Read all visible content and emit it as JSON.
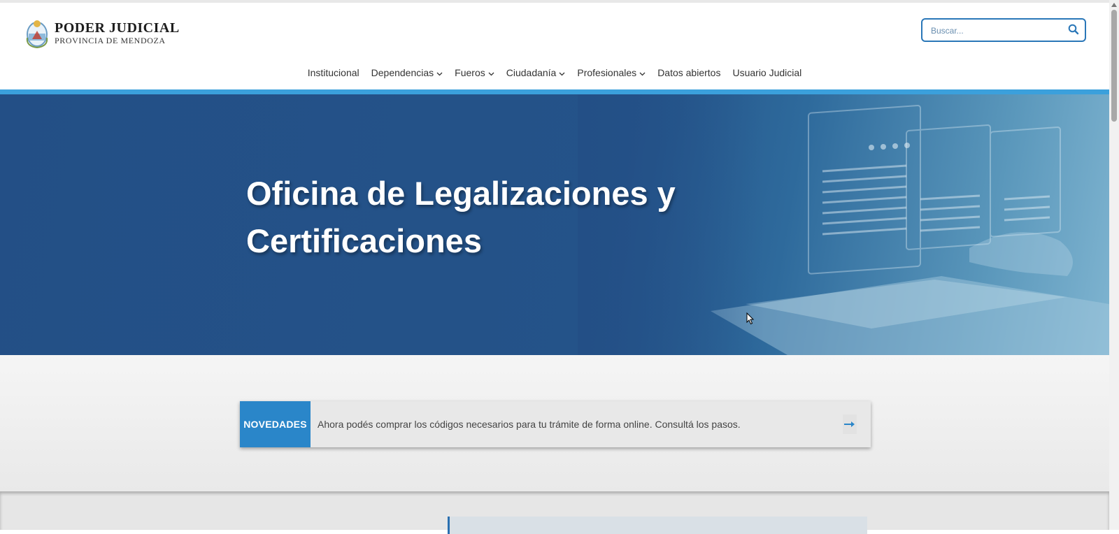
{
  "header": {
    "logo_title": "PODER JUDICIAL",
    "logo_subtitle": "PROVINCIA DE MENDOZA",
    "search_placeholder": "Buscar..."
  },
  "nav": {
    "items": [
      {
        "label": "Institucional",
        "dropdown": false
      },
      {
        "label": "Dependencias",
        "dropdown": true
      },
      {
        "label": "Fueros",
        "dropdown": true
      },
      {
        "label": "Ciudadanía",
        "dropdown": true
      },
      {
        "label": "Profesionales",
        "dropdown": true
      },
      {
        "label": "Datos abiertos",
        "dropdown": false
      },
      {
        "label": "Usuario Judicial",
        "dropdown": false
      }
    ]
  },
  "hero": {
    "title_line1": "Oficina de Legalizaciones y",
    "title_line2": "Certificaciones"
  },
  "news": {
    "label": "NOVEDADES",
    "text": "Ahora podés comprar los códigos necesarios para tu trámite de forma online. Consultá los pasos."
  },
  "colors": {
    "accent_bar": "#3ba0dc",
    "hero_bg": "#234f86",
    "news_label_bg": "#2a86c9",
    "search_border": "#2a77b8"
  },
  "icons": {
    "logo": "coat-of-arms-icon",
    "search": "search-icon",
    "chevron": "chevron-down-icon",
    "arrow": "arrow-right-icon"
  }
}
